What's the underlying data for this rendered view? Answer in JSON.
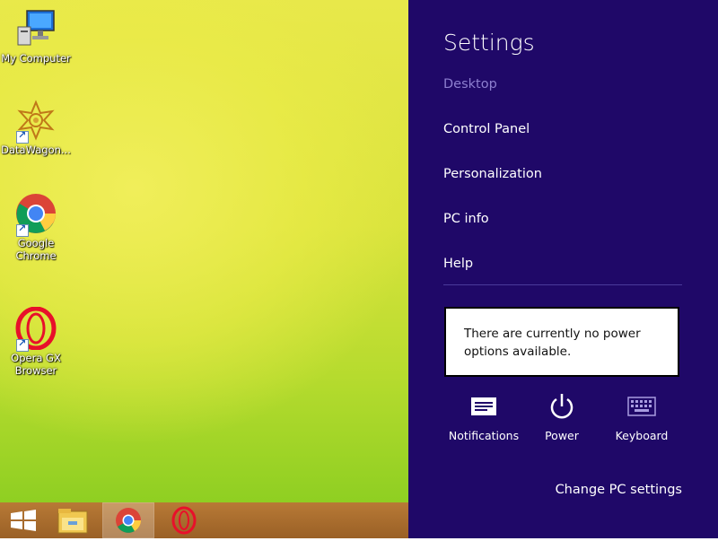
{
  "desktop": {
    "icons": [
      {
        "label": "My Computer",
        "icon": "computer-icon"
      },
      {
        "label": "DataWagon...",
        "icon": "datawagon-icon"
      },
      {
        "label": "Google Chrome",
        "icon": "chrome-icon"
      },
      {
        "label": "Opera GX Browser",
        "icon": "opera-gx-icon"
      }
    ]
  },
  "taskbar": {
    "items": [
      {
        "icon": "windows-start-icon"
      },
      {
        "icon": "file-explorer-icon"
      },
      {
        "icon": "chrome-icon",
        "active": true
      },
      {
        "icon": "opera-gx-icon"
      }
    ]
  },
  "charm": {
    "title": "Settings",
    "items": [
      {
        "label": "Desktop",
        "dim": true
      },
      {
        "label": "Control Panel"
      },
      {
        "label": "Personalization"
      },
      {
        "label": "PC info"
      },
      {
        "label": "Help"
      }
    ],
    "tooltip": "There are currently no power options available.",
    "quick_actions": [
      {
        "label": "Notifications",
        "icon": "notifications-icon"
      },
      {
        "label": "Power",
        "icon": "power-icon"
      },
      {
        "label": "Keyboard",
        "icon": "keyboard-icon"
      }
    ],
    "change_pc_settings": "Change PC settings"
  },
  "colors": {
    "charm_bg": "#1f0868",
    "dim_text": "#8d7fd0",
    "taskbar": "#a86c2c"
  }
}
